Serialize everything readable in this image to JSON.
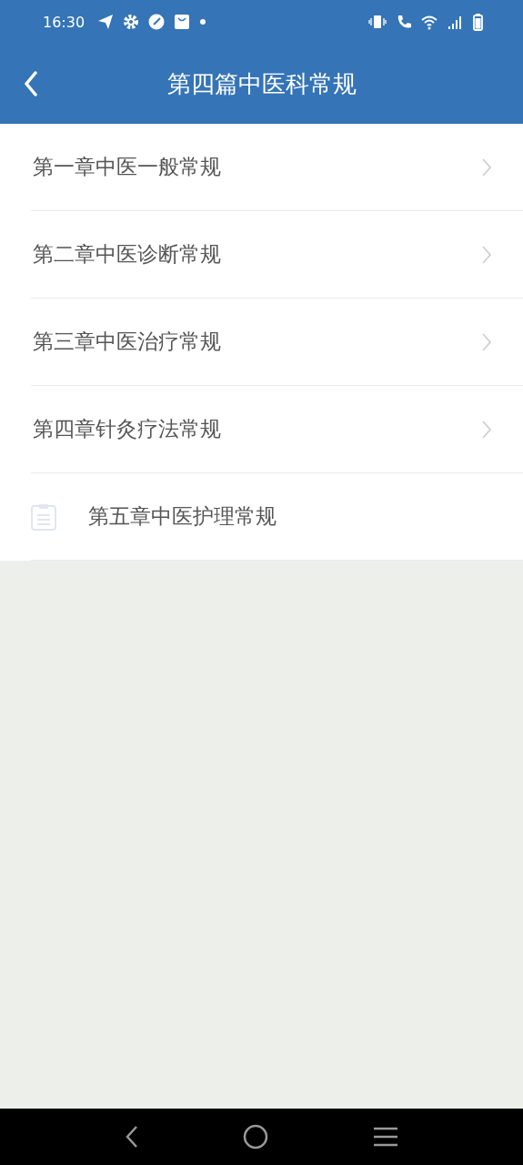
{
  "status_bar": {
    "time": "16:30"
  },
  "header": {
    "title": "第四篇中医科常规"
  },
  "items": [
    {
      "label": "第一章中医一般常规",
      "kind": "folder"
    },
    {
      "label": "第二章中医诊断常规",
      "kind": "folder"
    },
    {
      "label": "第三章中医治疗常规",
      "kind": "folder"
    },
    {
      "label": "第四章针灸疗法常规",
      "kind": "folder"
    },
    {
      "label": "第五章中医护理常规",
      "kind": "document"
    }
  ]
}
